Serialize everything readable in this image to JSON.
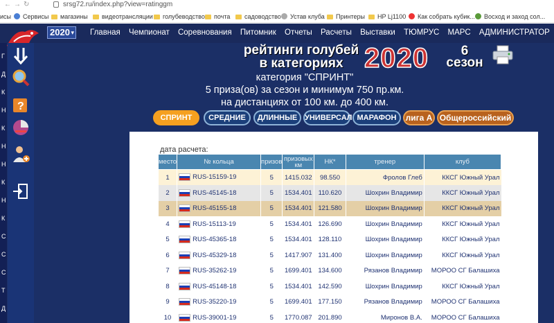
{
  "browser": {
    "url": "srsg72.ru/index.php?view=ratinggm",
    "bookmarks": [
      "исы",
      "Сервисы",
      "магазины",
      "видеотрансляции",
      "голубеводство",
      "почта",
      "садоводство",
      "Устав клуба",
      "Принтеры",
      "HP Lj1100",
      "Как собрать кубик...",
      "Восход и заход сол..."
    ]
  },
  "nav": {
    "year": "2020",
    "menu": [
      "Главная",
      "Чемпионат",
      "Соревнования",
      "Питомник",
      "Отчеты",
      "Расчеты",
      "Выставки",
      "ТЮМРУС",
      "МАРС",
      "АДМИНИСТРАТОР"
    ]
  },
  "sidebar_letters": [
    "Г",
    "Д",
    "К",
    "Н",
    "К",
    "Н",
    "Н",
    "К",
    "Н",
    "К",
    "С",
    "С",
    "С",
    "Т",
    "Д"
  ],
  "heading": {
    "title_line1": "рейтинги голубей",
    "title_line2": "в категориях",
    "year": "2020",
    "season_num": "6",
    "season_word": "сезон",
    "category": "категория \"СПРИНТ\"",
    "prizes": "5 приза(ов) за сезон и минимум 750 пр.км.",
    "distance": "на дистанциях от 100 км. до 400 км."
  },
  "categories": [
    "СПРИНТ",
    "СРЕДНИЕ",
    "ДЛИННЫЕ",
    "УНИВЕРСАЛ",
    "МАРАФОН",
    "лига А",
    "Общероссийский"
  ],
  "table": {
    "calc_label": "дата расчета:",
    "headers": [
      "место",
      "№ кольца",
      "призов",
      "призовых км",
      "НК*",
      "тренер",
      "клуб"
    ],
    "rows": [
      {
        "place": "1",
        "ring": "RUS-15159-19",
        "prizes": "5",
        "km": "1415.032",
        "nk": "98.550",
        "trainer": "Фролов Глеб",
        "club": "ККСГ Южный Урал"
      },
      {
        "place": "2",
        "ring": "RUS-45145-18",
        "prizes": "5",
        "km": "1534.401",
        "nk": "110.620",
        "trainer": "Шохрин Владимир",
        "club": "ККСГ Южный Урал"
      },
      {
        "place": "3",
        "ring": "RUS-45155-18",
        "prizes": "5",
        "km": "1534.401",
        "nk": "121.580",
        "trainer": "Шохрин Владимир",
        "club": "ККСГ Южный Урал"
      },
      {
        "place": "4",
        "ring": "RUS-15113-19",
        "prizes": "5",
        "km": "1534.401",
        "nk": "126.690",
        "trainer": "Шохрин Владимир",
        "club": "ККСГ Южный Урал"
      },
      {
        "place": "5",
        "ring": "RUS-45365-18",
        "prizes": "5",
        "km": "1534.401",
        "nk": "128.110",
        "trainer": "Шохрин Владимир",
        "club": "ККСГ Южный Урал"
      },
      {
        "place": "6",
        "ring": "RUS-45329-18",
        "prizes": "5",
        "km": "1417.907",
        "nk": "131.400",
        "trainer": "Шохрин Владимир",
        "club": "ККСГ Южный Урал"
      },
      {
        "place": "7",
        "ring": "RUS-35262-19",
        "prizes": "5",
        "km": "1699.401",
        "nk": "134.600",
        "trainer": "Рязанов Владимир",
        "club": "МОРОО СГ Балашиха"
      },
      {
        "place": "8",
        "ring": "RUS-45148-18",
        "prizes": "5",
        "km": "1534.401",
        "nk": "142.590",
        "trainer": "Шохрин Владимир",
        "club": "ККСГ Южный Урал"
      },
      {
        "place": "9",
        "ring": "RUS-35220-19",
        "prizes": "5",
        "km": "1699.401",
        "nk": "177.150",
        "trainer": "Рязанов Владимир",
        "club": "МОРОО СГ Балашиха"
      },
      {
        "place": "10",
        "ring": "RUS-39001-19",
        "prizes": "5",
        "km": "1770.087",
        "nk": "201.890",
        "trainer": "Миронов В.А.",
        "club": "МОРОО СГ Балашиха"
      }
    ]
  },
  "colors": {
    "accent": "#f5a020",
    "nav_bg": "#1b2f66",
    "header_bg": "#4a86b0"
  },
  "icons": {
    "flag": "russian-flag-icon"
  }
}
